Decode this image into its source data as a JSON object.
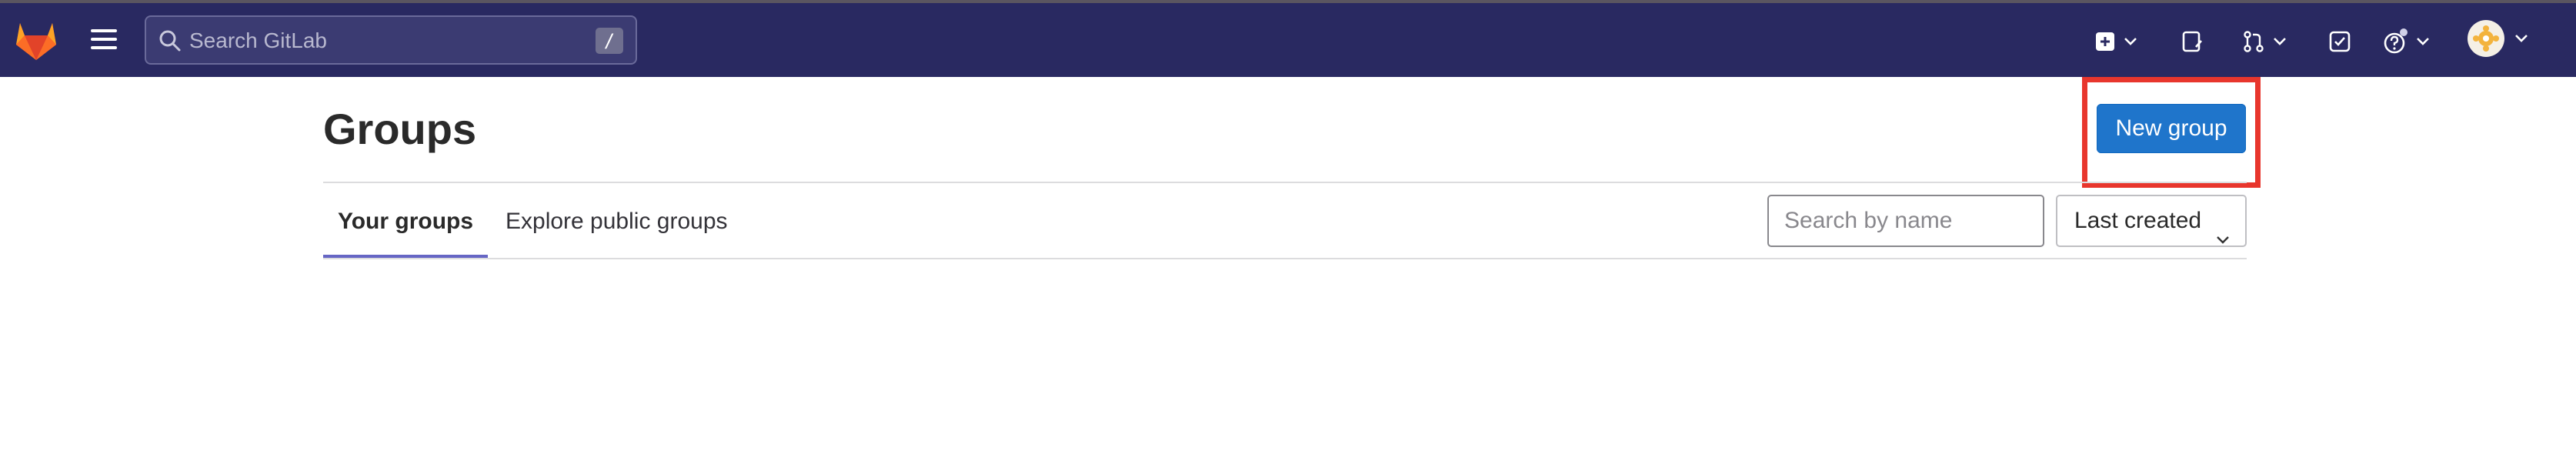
{
  "navbar": {
    "search_placeholder": "Search GitLab",
    "search_shortcut": "/",
    "icons": [
      "gitlab-logo",
      "hamburger-menu",
      "search",
      "create-new",
      "issues",
      "merge-requests",
      "todos",
      "help",
      "user-avatar"
    ],
    "bg_color": "#292961"
  },
  "page": {
    "title": "Groups",
    "new_group_label": "New group",
    "accent_color": "#1f75cb",
    "highlight_color": "#e8362d"
  },
  "tabs": [
    {
      "label": "Your groups",
      "active": true
    },
    {
      "label": "Explore public groups",
      "active": false
    }
  ],
  "filter": {
    "search_placeholder": "Search by name",
    "sort_label": "Last created"
  }
}
